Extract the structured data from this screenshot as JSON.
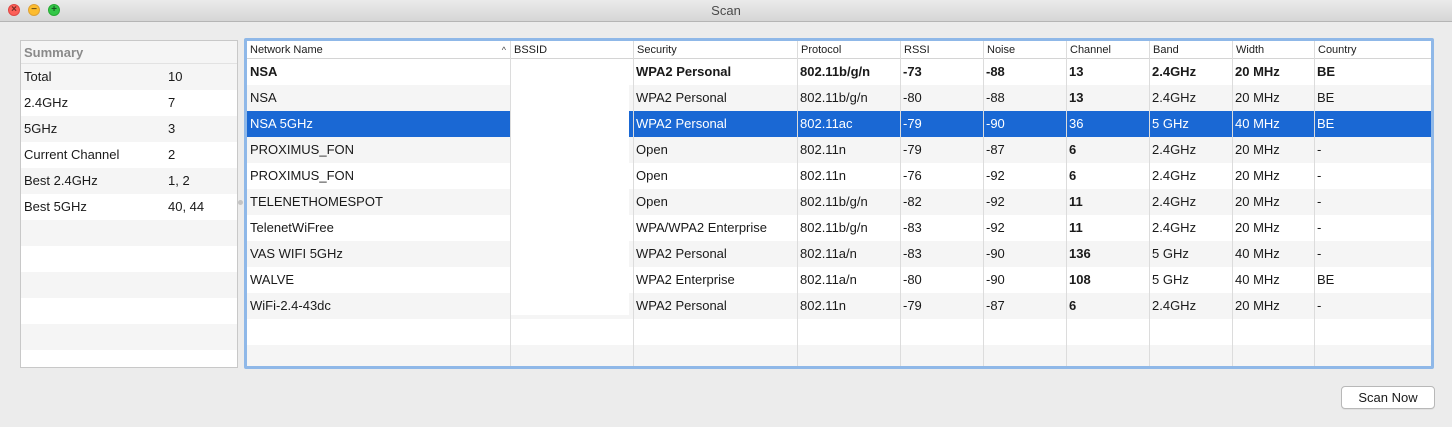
{
  "window": {
    "title": "Scan"
  },
  "summary": {
    "header": "Summary",
    "rows": [
      {
        "label": "Total",
        "value": "10"
      },
      {
        "label": "2.4GHz",
        "value": "7"
      },
      {
        "label": "5GHz",
        "value": "3"
      },
      {
        "label": "Current Channel",
        "value": "2"
      },
      {
        "label": "Best 2.4GHz",
        "value": "1, 2"
      },
      {
        "label": "Best 5GHz",
        "value": "40, 44"
      }
    ]
  },
  "table": {
    "columns": [
      "Network Name",
      "BSSID",
      "Security",
      "Protocol",
      "RSSI",
      "Noise",
      "Channel",
      "Band",
      "Width",
      "Country"
    ],
    "sort_indicator": "^",
    "rows": [
      {
        "name": "NSA",
        "bssid": "",
        "security": "WPA2 Personal",
        "protocol": "802.11b/g/n",
        "rssi": "-73",
        "noise": "-88",
        "channel": "13",
        "band": "2.4GHz",
        "width": "20 MHz",
        "country": "BE",
        "current": true
      },
      {
        "name": "NSA",
        "bssid": "",
        "security": "WPA2 Personal",
        "protocol": "802.11b/g/n",
        "rssi": "-80",
        "noise": "-88",
        "channel": "13",
        "band": "2.4GHz",
        "width": "20 MHz",
        "country": "BE"
      },
      {
        "name": "NSA 5GHz",
        "bssid": "",
        "security": "WPA2 Personal",
        "protocol": "802.11ac",
        "rssi": "-79",
        "noise": "-90",
        "channel": "36",
        "band": "5 GHz",
        "width": "40 MHz",
        "country": "BE",
        "selected": true
      },
      {
        "name": "PROXIMUS_FON",
        "bssid": "",
        "security": "Open",
        "protocol": "802.11n",
        "rssi": "-79",
        "noise": "-87",
        "channel": "6",
        "band": "2.4GHz",
        "width": "20 MHz",
        "country": "-"
      },
      {
        "name": "PROXIMUS_FON",
        "bssid": "",
        "security": "Open",
        "protocol": "802.11n",
        "rssi": "-76",
        "noise": "-92",
        "channel": "6",
        "band": "2.4GHz",
        "width": "20 MHz",
        "country": "-"
      },
      {
        "name": "TELENETHOMESPOT",
        "bssid": "",
        "security": "Open",
        "protocol": "802.11b/g/n",
        "rssi": "-82",
        "noise": "-92",
        "channel": "11",
        "band": "2.4GHz",
        "width": "20 MHz",
        "country": "-"
      },
      {
        "name": "TelenetWiFree",
        "bssid": "",
        "security": "WPA/WPA2 Enterprise",
        "protocol": "802.11b/g/n",
        "rssi": "-83",
        "noise": "-92",
        "channel": "11",
        "band": "2.4GHz",
        "width": "20 MHz",
        "country": "-"
      },
      {
        "name": "VAS WIFI 5GHz",
        "bssid": "",
        "security": "WPA2 Personal",
        "protocol": "802.11a/n",
        "rssi": "-83",
        "noise": "-90",
        "channel": "136",
        "band": "5 GHz",
        "width": "40 MHz",
        "country": "-"
      },
      {
        "name": "WALVE",
        "bssid": "",
        "security": "WPA2 Enterprise",
        "protocol": "802.11a/n",
        "rssi": "-80",
        "noise": "-90",
        "channel": "108",
        "band": "5 GHz",
        "width": "40 MHz",
        "country": "BE"
      },
      {
        "name": "WiFi-2.4-43dc",
        "bssid": "",
        "security": "WPA2 Personal",
        "protocol": "802.11n",
        "rssi": "-79",
        "noise": "-87",
        "channel": "6",
        "band": "2.4GHz",
        "width": "20 MHz",
        "country": "-"
      }
    ]
  },
  "buttons": {
    "scan_now": "Scan Now"
  },
  "colors": {
    "selection": "#1a68d4",
    "focus_ring": "#8fb8e8"
  }
}
